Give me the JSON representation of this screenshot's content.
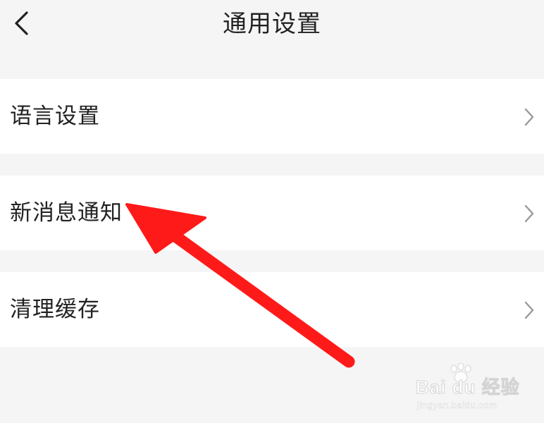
{
  "header": {
    "title": "通用设置",
    "back_icon": "chevron-left-icon"
  },
  "settings": {
    "items": [
      {
        "label": "语言设置",
        "icon": "chevron-right-icon"
      },
      {
        "label": "新消息通知",
        "icon": "chevron-right-icon"
      },
      {
        "label": "清理缓存",
        "icon": "chevron-right-icon"
      }
    ]
  },
  "annotation": {
    "arrow_color": "#ff1a1a"
  },
  "watermark": {
    "brand": "Bai du 经验",
    "url": "jingyan.baidu.com"
  },
  "colors": {
    "background": "#f5f5f5",
    "row": "#ffffff",
    "text": "#222222",
    "chevron": "#999999"
  }
}
